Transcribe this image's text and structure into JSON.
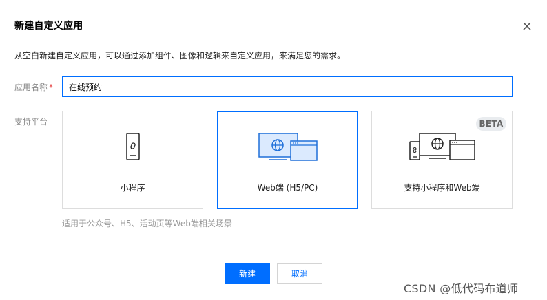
{
  "dialog": {
    "title": "新建自定义应用",
    "description": "从空白新建自定义应用，可以通过添加组件、图像和逻辑来自定义应用，来满足您的需求。",
    "close_icon": "close-icon"
  },
  "form": {
    "name_label": "应用名称",
    "required_mark": "*",
    "name_value": "在线预约",
    "platform_label": "支持平台",
    "platforms": [
      {
        "label": "小程序",
        "icon": "mobile-miniprogram-icon",
        "selected": false,
        "badge": ""
      },
      {
        "label": "Web端 (H5/PC)",
        "icon": "web-desktop-icon",
        "selected": true,
        "badge": ""
      },
      {
        "label": "支持小程序和Web端",
        "icon": "multi-platform-icon",
        "selected": false,
        "badge": "BETA"
      }
    ],
    "hint": "适用于公众号、H5、活动页等Web端相关场景"
  },
  "actions": {
    "create_label": "新建",
    "cancel_label": "取消"
  },
  "watermark": "CSDN @低代码布道师",
  "colors": {
    "accent": "#006eff",
    "required": "#e54545",
    "icon_fill": "#dbeafe"
  }
}
